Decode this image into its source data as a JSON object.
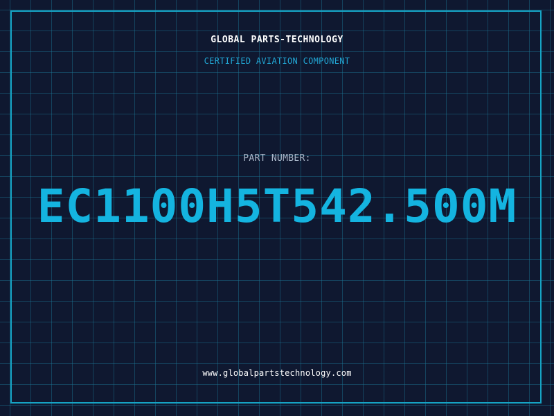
{
  "header": {
    "brand_name": "GLOBAL PARTS-TECHNOLOGY",
    "tagline": "CERTIFIED AVIATION COMPONENT"
  },
  "part": {
    "label": "PART NUMBER:",
    "number": "EC1100H5T542.500M"
  },
  "footer": {
    "website": "www.globalpartstechnology.com"
  },
  "colors": {
    "background": "#0f1830",
    "grid": "#1c7896",
    "frame": "#16a3c4",
    "accent": "#14b4e0",
    "tagline": "#22a8d6",
    "label": "#a9b6c8",
    "text": "#ffffff"
  }
}
